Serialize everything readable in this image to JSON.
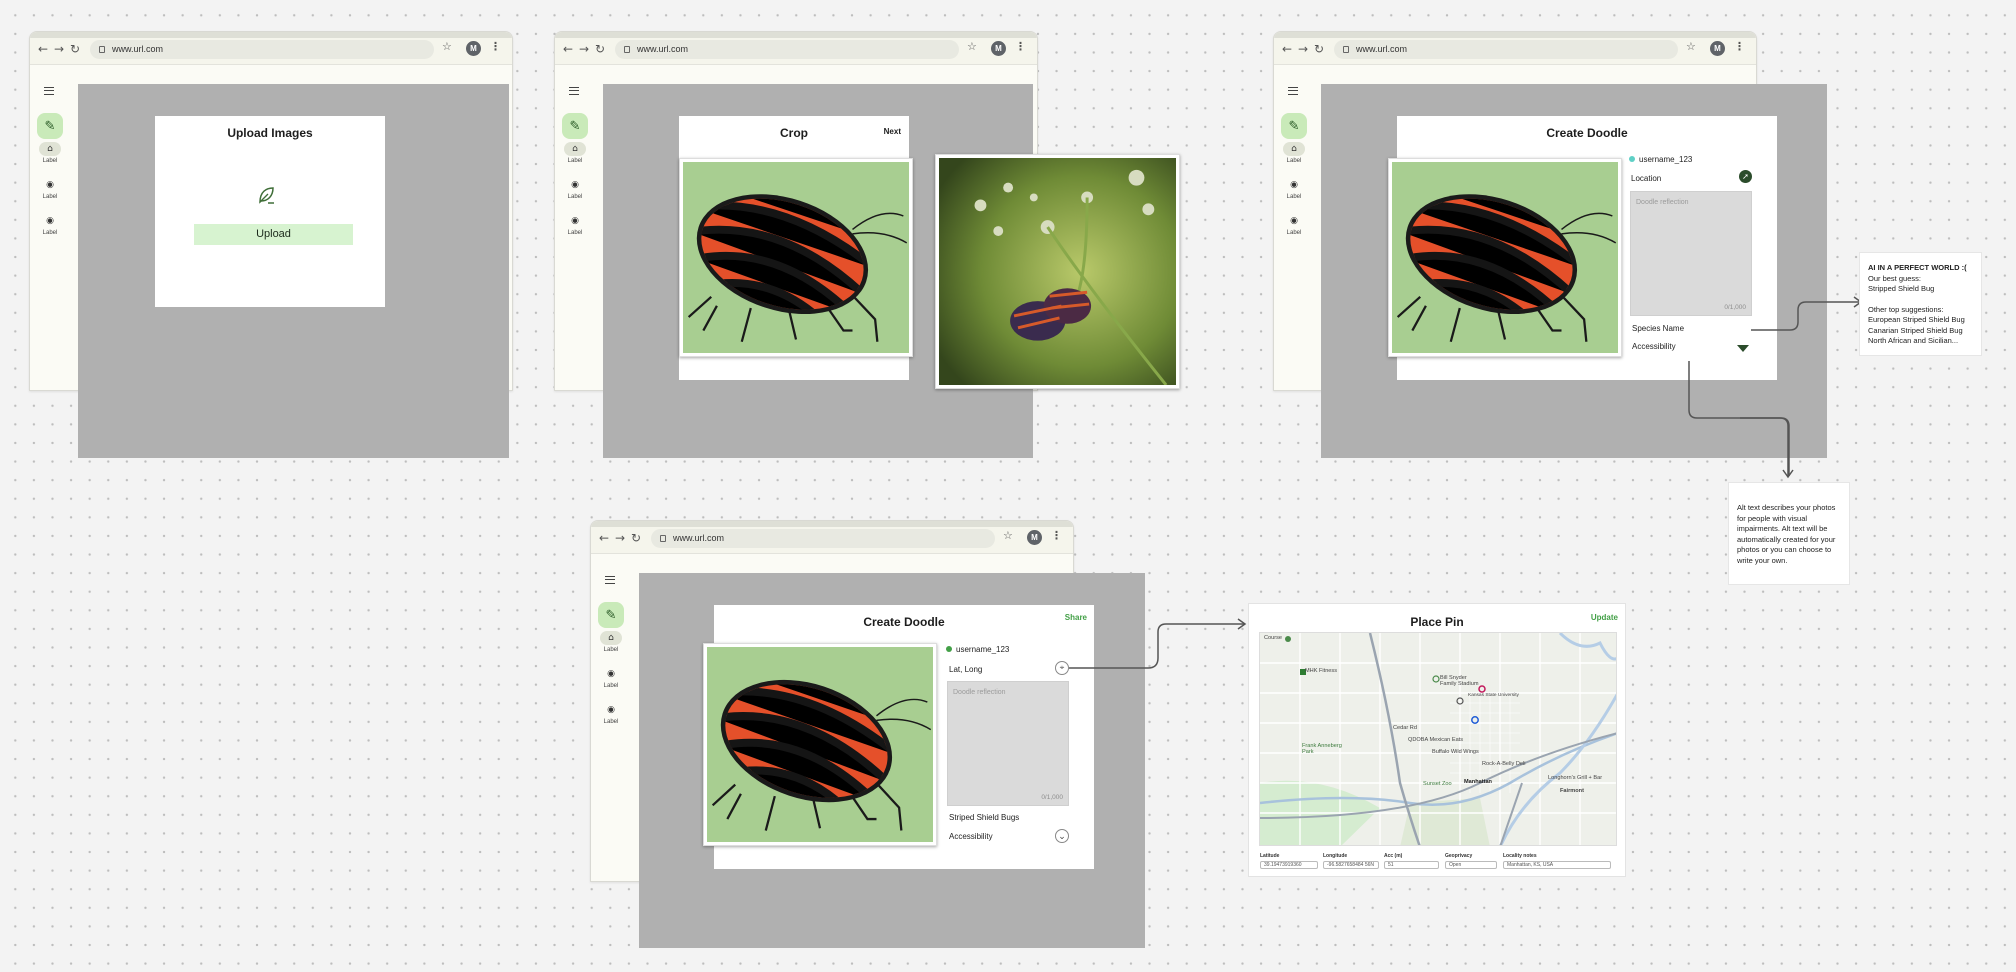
{
  "browser": {
    "url": "www.url.com",
    "avatar_initial": "M"
  },
  "rail": {
    "items": [
      {
        "label": "Label",
        "icon": "home-icon"
      },
      {
        "label": "Label",
        "icon": "radio-icon"
      },
      {
        "label": "Label",
        "icon": "radio-icon"
      }
    ]
  },
  "upload": {
    "title": "Upload Images",
    "button": "Upload"
  },
  "crop": {
    "title": "Crop",
    "next": "Next"
  },
  "create": {
    "title": "Create Doodle",
    "username": "username_123",
    "location": "Location",
    "reflection_placeholder": "Doodle reflection",
    "counter": "0/1,000",
    "species": "Species Name",
    "accessibility": "Accessibility"
  },
  "create2": {
    "title": "Create Doodle",
    "share": "Share",
    "username": "username_123",
    "latlong": "Lat, Long",
    "reflection_placeholder": "Doodle reflection",
    "counter": "0/1,000",
    "species": "Striped Shield Bugs",
    "accessibility": "Accessibility"
  },
  "ai_note": {
    "heading": "AI IN A PERFECT WORLD :(",
    "line1": "Our best guess:",
    "line2": "Stripped Shield Bug",
    "line3": "Other top suggestions:",
    "line4": "European Striped Shield Bug",
    "line5": "Canarian Striped Shield Bug",
    "line6": "North African and Sicilian..."
  },
  "alt_note": {
    "text": "Alt text describes your photos for people with visual impairments. Alt text will be automatically created for your photos or you can choose to write your own."
  },
  "place_pin": {
    "title": "Place Pin",
    "update": "Update",
    "fields": [
      {
        "label": "Latitude",
        "value": "39.19473919360"
      },
      {
        "label": "Longitude",
        "value": "-96.5827658484 56N"
      },
      {
        "label": "Acc (m)",
        "value": "51"
      },
      {
        "label": "Geoprivacy",
        "value": "Open"
      },
      {
        "label": "Locality notes",
        "value": "Manhattan, KS, USA"
      }
    ],
    "map_labels": {
      "a": "MHK Fitness",
      "b": "Kansas State University",
      "c": "Bill Snyder Family Stadium",
      "d": "Frank Anneberg Park",
      "e": "Manhattan",
      "f": "Sunset Zoo",
      "g": "QDOBA Mexican Eats",
      "h": "Buffalo Wild Wings",
      "i": "Rock-A-Belly Deli",
      "j": "Longhorn's Grill + Bar",
      "k": "Fairmont",
      "l": "Cedar Rd",
      "m": "Course"
    }
  },
  "colors": {
    "accent_green": "#c9eab9",
    "upload_green": "#d7f3d0",
    "overlay": "#b0b0b0",
    "link_green": "#43a047"
  }
}
